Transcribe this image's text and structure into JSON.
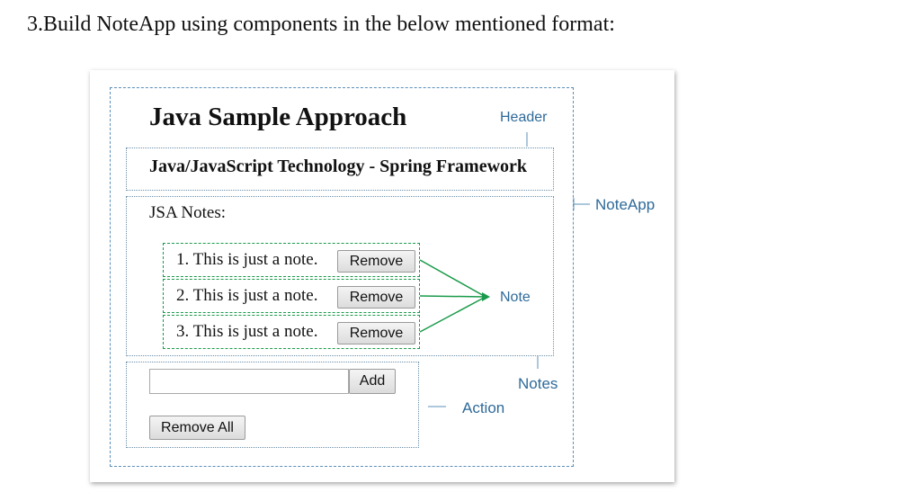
{
  "question": "3.Build NoteApp using components in the below mentioned format:",
  "app": {
    "title": "Java Sample Approach",
    "subtitle": "Java/JavaScript Technology - Spring Framework",
    "notes_title": "JSA Notes:",
    "notes": [
      {
        "text": "1. This is just a note.",
        "remove_label": "Remove"
      },
      {
        "text": "2. This is just a note.",
        "remove_label": "Remove"
      },
      {
        "text": "3. This is just a note.",
        "remove_label": "Remove"
      }
    ],
    "input": {
      "value": "",
      "placeholder": ""
    },
    "add_label": "Add",
    "remove_all_label": "Remove All"
  },
  "annotations": {
    "header": "Header",
    "noteapp": "NoteApp",
    "note": "Note",
    "notes": "Notes",
    "action": "Action"
  },
  "colors": {
    "annotation_text": "#2e6a9a",
    "annotation_line": "#5b8fb9",
    "note_border": "#1a9a4a"
  }
}
